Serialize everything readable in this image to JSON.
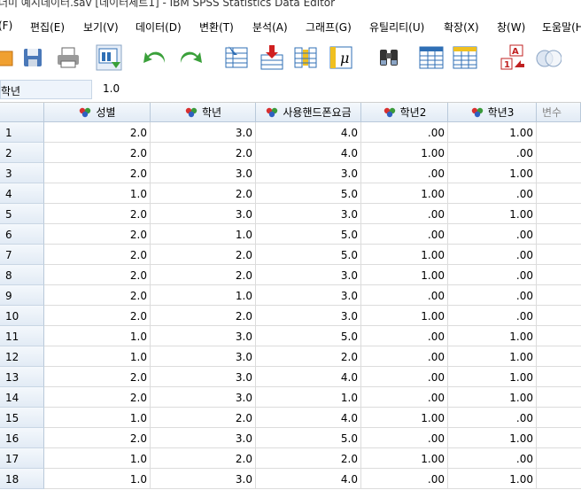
{
  "window": {
    "title": "더미 예시데이터.sav [데이터세트1] - IBM SPSS Statistics Data Editor"
  },
  "menu": {
    "items": [
      "(F)",
      "편집(E)",
      "보기(V)",
      "데이터(D)",
      "변환(T)",
      "분석(A)",
      "그래프(G)",
      "유틸리티(U)",
      "확장(X)",
      "창(W)",
      "도움말(H"
    ]
  },
  "toolbar": {
    "icons": [
      "open-data-icon",
      "save-icon",
      "print-icon",
      "recall-dialog-icon",
      "undo-icon",
      "redo-icon",
      "go-to-case-icon",
      "insert-cases-icon",
      "insert-variable-icon",
      "variables-icon",
      "find-icon",
      "split-file-icon",
      "select-cases-icon",
      "value-labels-icon",
      "use-sets-icon"
    ]
  },
  "cell_editor": {
    "name": "학년",
    "value": "1.0"
  },
  "grid": {
    "columns": [
      "성별",
      "학년",
      "사용핸드폰요금",
      "학년2",
      "학년3"
    ],
    "empty_column": "변수",
    "rows": [
      {
        "n": "1",
        "v": [
          "2.0",
          "3.0",
          "4.0",
          ".00",
          "1.00"
        ]
      },
      {
        "n": "2",
        "v": [
          "2.0",
          "2.0",
          "4.0",
          "1.00",
          ".00"
        ]
      },
      {
        "n": "3",
        "v": [
          "2.0",
          "3.0",
          "3.0",
          ".00",
          "1.00"
        ]
      },
      {
        "n": "4",
        "v": [
          "1.0",
          "2.0",
          "5.0",
          "1.00",
          ".00"
        ]
      },
      {
        "n": "5",
        "v": [
          "2.0",
          "3.0",
          "3.0",
          ".00",
          "1.00"
        ]
      },
      {
        "n": "6",
        "v": [
          "2.0",
          "1.0",
          "5.0",
          ".00",
          ".00"
        ]
      },
      {
        "n": "7",
        "v": [
          "2.0",
          "2.0",
          "5.0",
          "1.00",
          ".00"
        ]
      },
      {
        "n": "8",
        "v": [
          "2.0",
          "2.0",
          "3.0",
          "1.00",
          ".00"
        ]
      },
      {
        "n": "9",
        "v": [
          "2.0",
          "1.0",
          "3.0",
          ".00",
          ".00"
        ]
      },
      {
        "n": "10",
        "v": [
          "2.0",
          "2.0",
          "3.0",
          "1.00",
          ".00"
        ]
      },
      {
        "n": "11",
        "v": [
          "1.0",
          "3.0",
          "5.0",
          ".00",
          "1.00"
        ]
      },
      {
        "n": "12",
        "v": [
          "1.0",
          "3.0",
          "2.0",
          ".00",
          "1.00"
        ]
      },
      {
        "n": "13",
        "v": [
          "2.0",
          "3.0",
          "4.0",
          ".00",
          "1.00"
        ]
      },
      {
        "n": "14",
        "v": [
          "2.0",
          "3.0",
          "1.0",
          ".00",
          "1.00"
        ]
      },
      {
        "n": "15",
        "v": [
          "1.0",
          "2.0",
          "4.0",
          "1.00",
          ".00"
        ]
      },
      {
        "n": "16",
        "v": [
          "2.0",
          "3.0",
          "5.0",
          ".00",
          "1.00"
        ]
      },
      {
        "n": "17",
        "v": [
          "1.0",
          "2.0",
          "2.0",
          "1.00",
          ".00"
        ]
      },
      {
        "n": "18",
        "v": [
          "1.0",
          "3.0",
          "4.0",
          ".00",
          "1.00"
        ]
      }
    ]
  }
}
